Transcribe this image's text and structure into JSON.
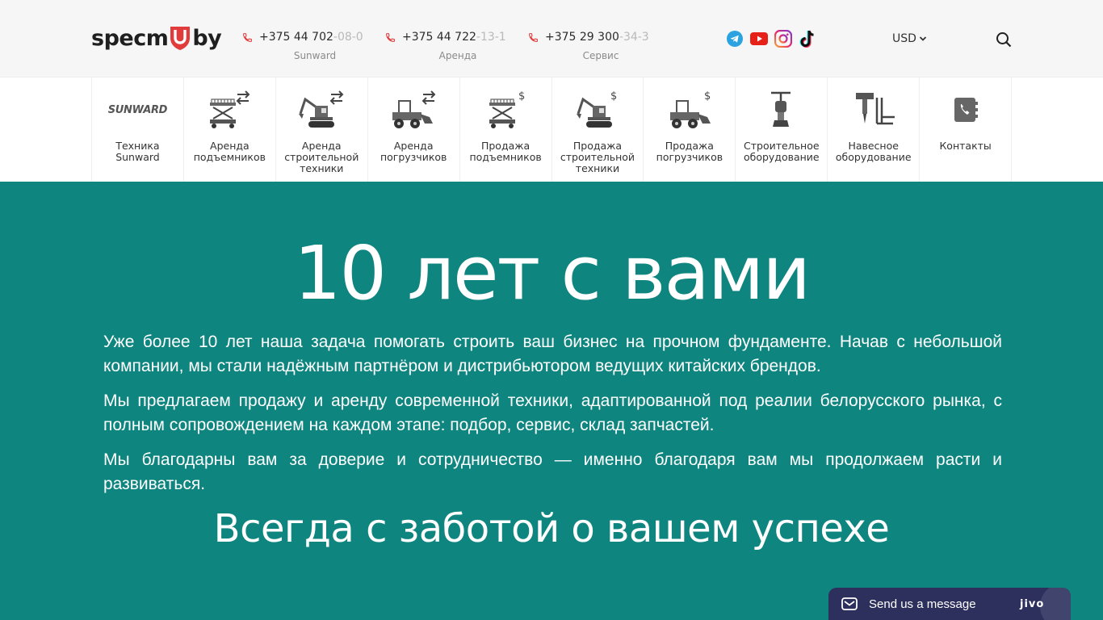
{
  "header": {
    "logo_text_left": "specm",
    "logo_text_right": "by",
    "phones": [
      {
        "number": "+375 44 702",
        "number_tail": "-08-0",
        "caption": "Sunward"
      },
      {
        "number": "+375 44 722",
        "number_tail": "-13-1",
        "caption": "Аренда"
      },
      {
        "number": "+375 29 300",
        "number_tail": "-34-3",
        "caption": "Сервис"
      }
    ],
    "socials": [
      "telegram-icon",
      "youtube-icon",
      "instagram-icon",
      "tiktok-icon"
    ],
    "currency": "USD",
    "accent_color": "#e23b3b"
  },
  "nav": {
    "items": [
      {
        "label": "Техника\nSunward",
        "icon": "sunward-logo"
      },
      {
        "label": "Аренда\nподъемников",
        "icon": "scissor-lift-rent-icon"
      },
      {
        "label": "Аренда\nстроительной\nтехники",
        "icon": "excavator-rent-icon"
      },
      {
        "label": "Аренда\nпогрузчиков",
        "icon": "loader-rent-icon"
      },
      {
        "label": "Продажа\nподъемников",
        "icon": "scissor-lift-sale-icon"
      },
      {
        "label": "Продажа\nстроительной\nтехники",
        "icon": "excavator-sale-icon"
      },
      {
        "label": "Продажа\nпогрузчиков",
        "icon": "loader-sale-icon"
      },
      {
        "label": "Строительное\nоборудование",
        "icon": "rammer-icon"
      },
      {
        "label": "Навесное\nоборудование",
        "icon": "attachment-icon"
      },
      {
        "label": "Контакты",
        "icon": "contacts-icon"
      }
    ],
    "sunward_logo_text": "SUNWARD"
  },
  "hero": {
    "title": "10 лет с вами",
    "paragraph1": "Уже более 10 лет наша задача помогать строить ваш бизнес на прочном фундаменте. Начав с небольшой компании, мы стали надёжным партнёром и дистрибьютором ведущих китайских брендов.",
    "paragraph2": "Мы предлагаем продажу и аренду современной техники, адаптированной под реалии белорусского рынка, с полным сопровождением на каждом этапе: подбор, сервис, склад запчастей.",
    "paragraph3": "Мы благодарны вам за доверие и сотрудничество — именно благодаря вам мы продолжаем расти и развиваться.",
    "slogan": "Всегда с заботой о вашем успехе",
    "background_color": "#0f8580"
  },
  "chat": {
    "label": "Send us a message",
    "brand": "jivo"
  }
}
